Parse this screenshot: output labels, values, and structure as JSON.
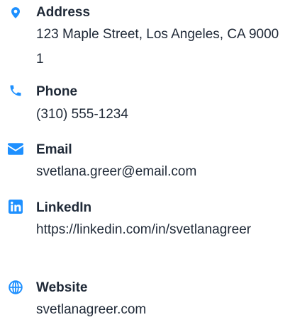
{
  "accent_color": "#1e90ff",
  "contacts": [
    {
      "icon": "location-pin-icon",
      "label": "Address",
      "value": "123 Maple Street, Los Angeles, CA 90001"
    },
    {
      "icon": "phone-icon",
      "label": "Phone",
      "value": "(310) 555-1234"
    },
    {
      "icon": "envelope-icon",
      "label": "Email",
      "value": "svetlana.greer@email.com"
    },
    {
      "icon": "linkedin-icon",
      "label": "LinkedIn",
      "value": "https://linkedin.com/in/svetlanagreer"
    },
    {
      "icon": "globe-icon",
      "label": "Website",
      "value": "svetlanagreer.com"
    }
  ]
}
